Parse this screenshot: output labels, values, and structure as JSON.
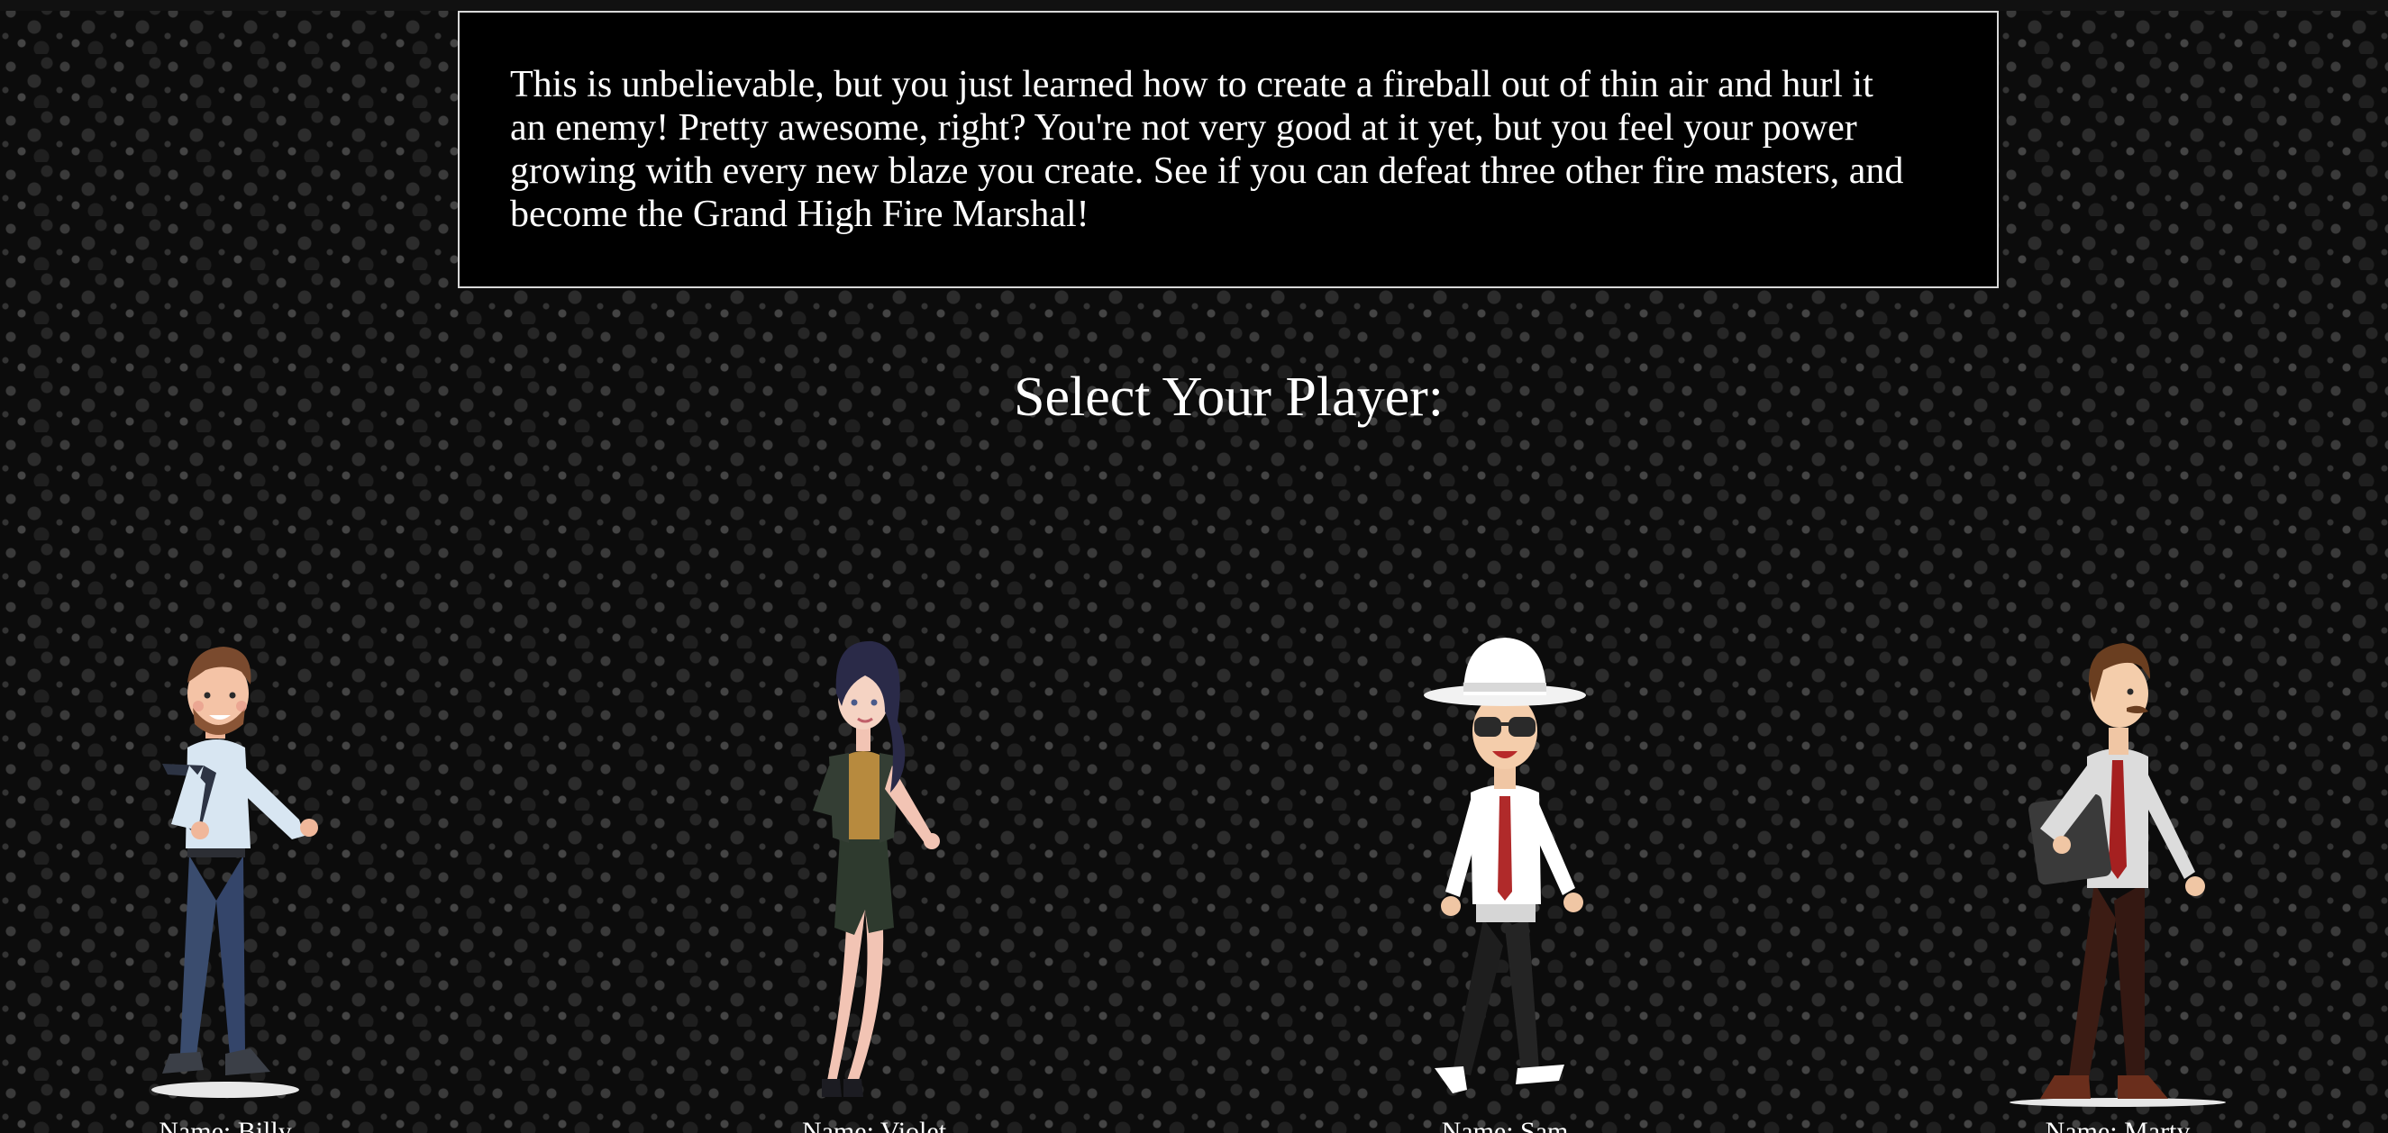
{
  "intro": {
    "text": "This is unbelievable, but you just learned how to create a fireball out of thin air and hurl it an enemy! Pretty awesome, right? You're not very good at it yet, but you feel your power growing with every new blaze you create. See if you can defeat three other fire masters, and become the Grand High Fire Marshal!"
  },
  "select": {
    "title": "Select Your Player:"
  },
  "players": [
    {
      "name_label": "Name: Billy",
      "figure": "bearded-man-pointing"
    },
    {
      "name_label": "Name: Violet",
      "figure": "woman-green-skirt"
    },
    {
      "name_label": "Name: Sam",
      "figure": "man-white-hat-sunglasses"
    },
    {
      "name_label": "Name: Marty",
      "figure": "man-mustache-laptop"
    }
  ],
  "colors": {
    "background": "#0c0c0c",
    "panel": "#000000",
    "panel_border": "#d8d8d8",
    "text": "#ffffff"
  }
}
